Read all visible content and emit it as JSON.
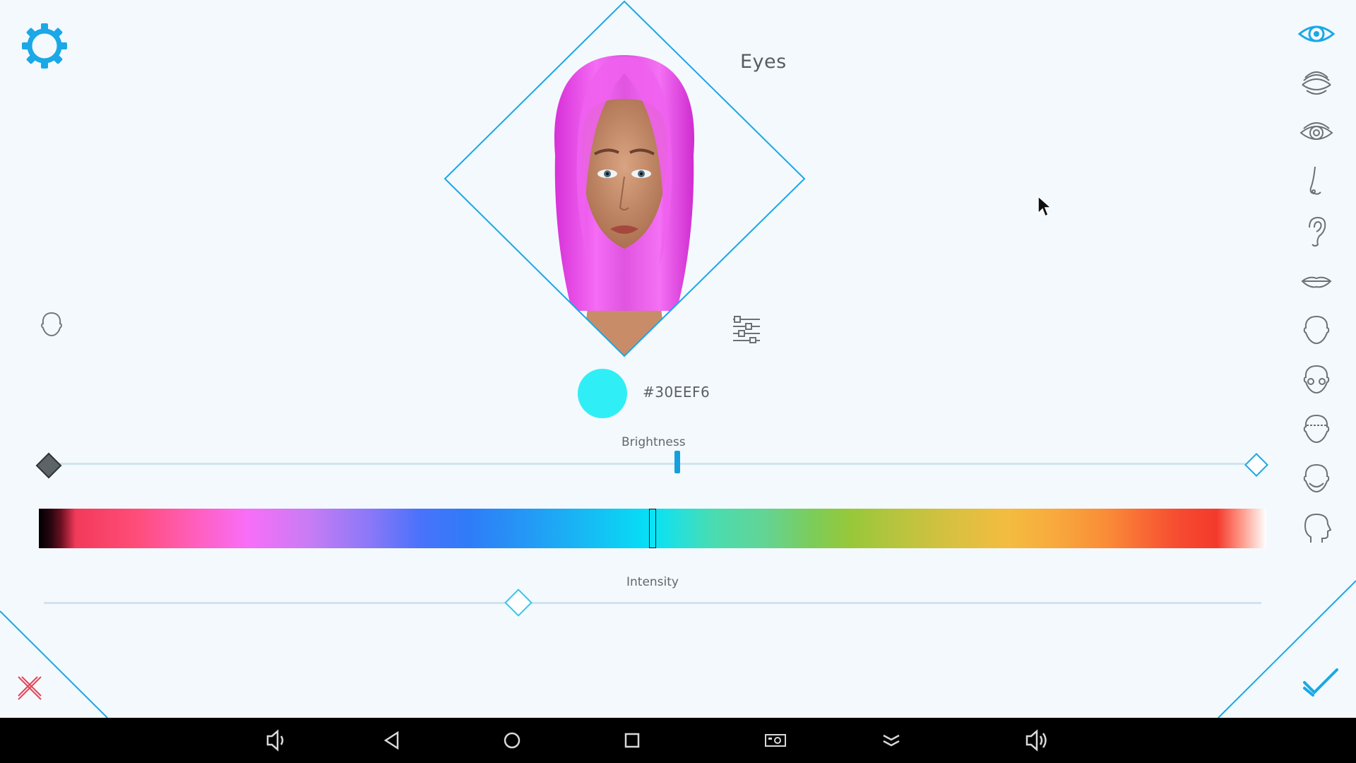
{
  "app": {
    "section_title": "Eyes",
    "accent_color": "#1aa8e6",
    "cancel_color": "#e2485a"
  },
  "color": {
    "hex_label": "#30EEF6",
    "swatch": "#30eef6"
  },
  "brightness": {
    "label": "Brightness",
    "value_fraction": 0.52
  },
  "hue": {
    "value_fraction": 0.5
  },
  "intensity": {
    "label": "Intensity",
    "value_fraction": 0.39
  },
  "icons": {
    "settings": "gear-icon",
    "head_toggle": "head-outline-icon",
    "advanced": "sliders-icon",
    "cancel": "close-icon",
    "confirm": "checkmark-icon",
    "preview_image": "avatar-face-preview"
  },
  "sidebar": {
    "items": [
      {
        "id": "eyes-color",
        "icon": "eye-color-icon",
        "active": true
      },
      {
        "id": "eyelashes",
        "icon": "eyelashes-icon",
        "active": false
      },
      {
        "id": "eye-shape",
        "icon": "eye-shape-icon",
        "active": false
      },
      {
        "id": "nose",
        "icon": "nose-icon",
        "active": false
      },
      {
        "id": "ear",
        "icon": "ear-icon",
        "active": false
      },
      {
        "id": "lips",
        "icon": "lips-icon",
        "active": false
      },
      {
        "id": "face-front",
        "icon": "face-front-icon",
        "active": false
      },
      {
        "id": "face-cheeks",
        "icon": "face-cheeks-icon",
        "active": false
      },
      {
        "id": "face-forehead",
        "icon": "face-forehead-icon",
        "active": false
      },
      {
        "id": "face-jaw",
        "icon": "face-jaw-icon",
        "active": false
      },
      {
        "id": "head-profile",
        "icon": "head-profile-icon",
        "active": false
      }
    ]
  },
  "navbar": {
    "buttons": [
      {
        "id": "volume-down",
        "icon": "volume-down-icon"
      },
      {
        "id": "back",
        "icon": "back-triangle-icon"
      },
      {
        "id": "home",
        "icon": "home-circle-icon"
      },
      {
        "id": "recents",
        "icon": "recents-square-icon"
      },
      {
        "id": "screenshot",
        "icon": "screenshot-icon"
      },
      {
        "id": "collapse",
        "icon": "chevrons-down-icon"
      },
      {
        "id": "volume-up",
        "icon": "volume-up-icon"
      }
    ]
  }
}
